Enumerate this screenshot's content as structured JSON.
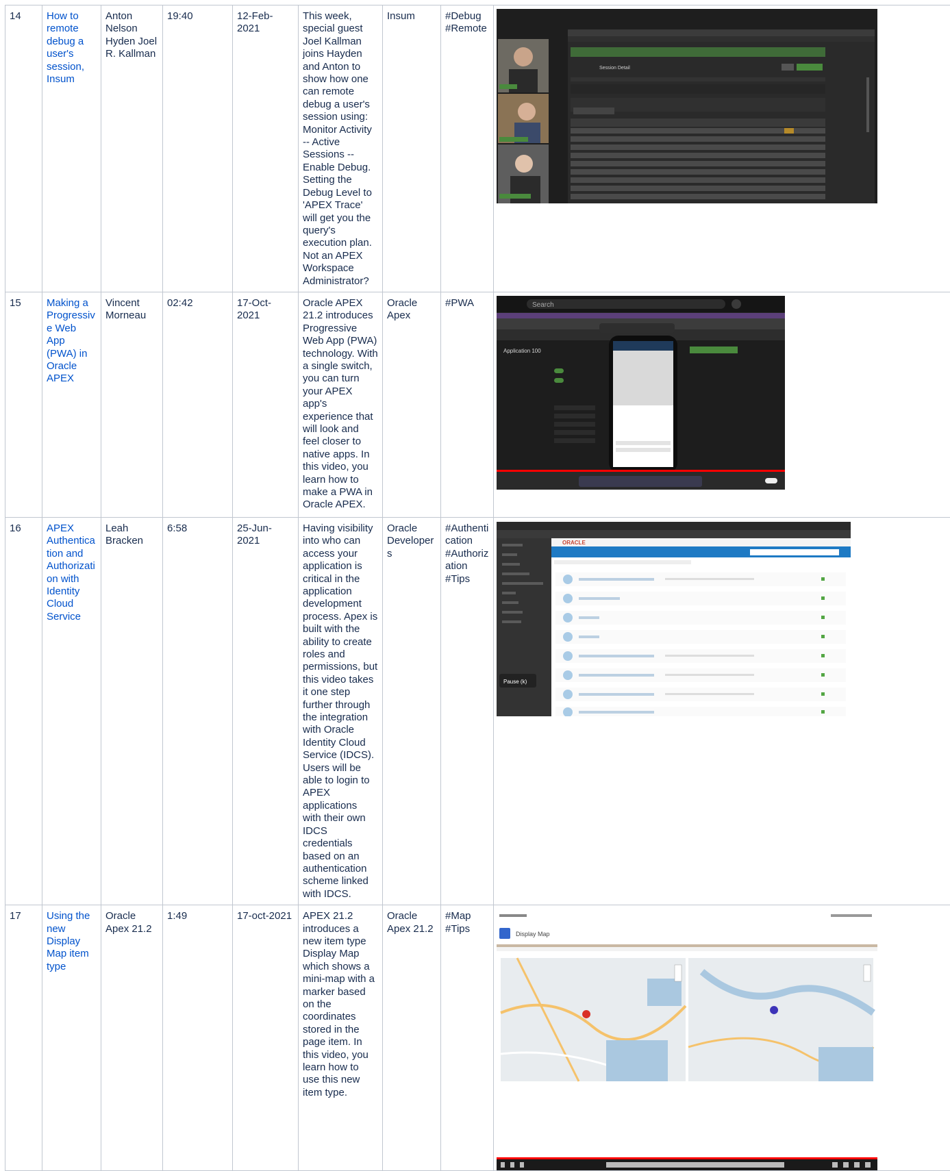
{
  "rows": [
    {
      "num": "14",
      "title": "How to remote debug a user's session, Insum",
      "presenters": "Anton Nelson Hyden Joel R. Kallman",
      "duration": "19:40",
      "date": "12-Feb-2021",
      "description": "This week, special guest Joel Kallman joins Hayden and Anton to show how one can remote debug a user's session using: Monitor Activity -- Active Sessions -- Enable Debug. Setting the Debug Level to 'APEX Trace' will get you the query's execution plan. Not an APEX Workspace Administrator?",
      "channel": "Insum",
      "tags": "#Debug #Remote",
      "thumbnail": {
        "page_title": "Session Detail",
        "participants": [
          "Hyden",
          "Anton Nelson",
          "Joel R. Kallman"
        ]
      }
    },
    {
      "num": "15",
      "title": "Making a Progressive Web App (PWA) in Oracle APEX",
      "presenters": "Vincent Morneau",
      "duration": "02:42",
      "date": "17-Oct-2021",
      "description": "Oracle APEX 21.2 introduces Progressive Web App (PWA) technology. With a single switch, you can turn your APEX app's experience that will look and feel closer to native apps. In this video, you learn how to make a PWA in Oracle APEX.",
      "channel": "Oracle Apex",
      "tags": "#PWA",
      "thumbnail": {
        "search_text": "Search",
        "app_title": "Application 100"
      }
    },
    {
      "num": "16",
      "title": "APEX Authentication and Authorization with Identity Cloud Service",
      "presenters": "Leah Bracken",
      "duration": "6:58",
      "date": "25-Jun-2021",
      "description": "Having visibility into who can access your application is critical in the application development process. Apex is built with the ability to create roles and permissions, but this video takes it one step further through the integration with Oracle Identity Cloud Service (IDCS). Users will be able to login to APEX applications with their own IDCS credentials based on an authentication scheme linked with IDCS.",
      "channel": "Oracle Developers",
      "tags": "#Authentication #Authorization #Tips",
      "thumbnail": {
        "brand": "ORACLE",
        "side_button": "Pause (k)"
      }
    },
    {
      "num": "17",
      "title": "Using the new Display Map item type",
      "presenters": "Oracle Apex 21.2",
      "duration": "1:49",
      "date": "17-oct-2021",
      "description": "APEX 21.2 introduces a new item type Display Map which shows a mini-map with a marker based on the coordinates stored in the page item. In this video, you learn how to use this new item type.",
      "channel": "Oracle Apex 21.2",
      "tags": "#Map #Tips",
      "thumbnail": {
        "region_title": "Display Map"
      }
    }
  ],
  "colors": {
    "link": "#0052cc",
    "border": "#c1c7d0",
    "text": "#172b4d",
    "apex_green": "#4a8a3d",
    "youtube_red": "#ff0000"
  }
}
